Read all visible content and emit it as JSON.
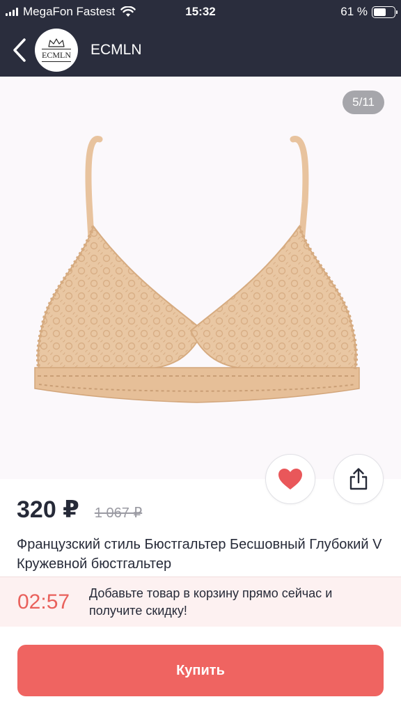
{
  "status_bar": {
    "carrier": "MegaFon Fastest",
    "time": "15:32",
    "battery_text": "61 %",
    "battery_level": 0.61
  },
  "nav": {
    "back_icon": "chevron-left-icon",
    "logo_text": "ECMLN",
    "shop_name": "ECMLN"
  },
  "gallery": {
    "counter": "5/11",
    "background": "#fbf8fb"
  },
  "actions": {
    "favorite_icon": "heart-icon",
    "favorite_color": "#e9575a",
    "share_icon": "share-icon"
  },
  "product": {
    "price": "320 ₽",
    "old_price": "1 067 ₽",
    "title": "Французский стиль Бюстгальтер Бесшовный Глубокий V Кружевной бюстгальтер"
  },
  "promo": {
    "timer": "02:57",
    "text": "Добавьте товар в корзину прямо сейчас и получите скидку!"
  },
  "buy_button": {
    "label": "Купить",
    "color": "#ef6461"
  }
}
